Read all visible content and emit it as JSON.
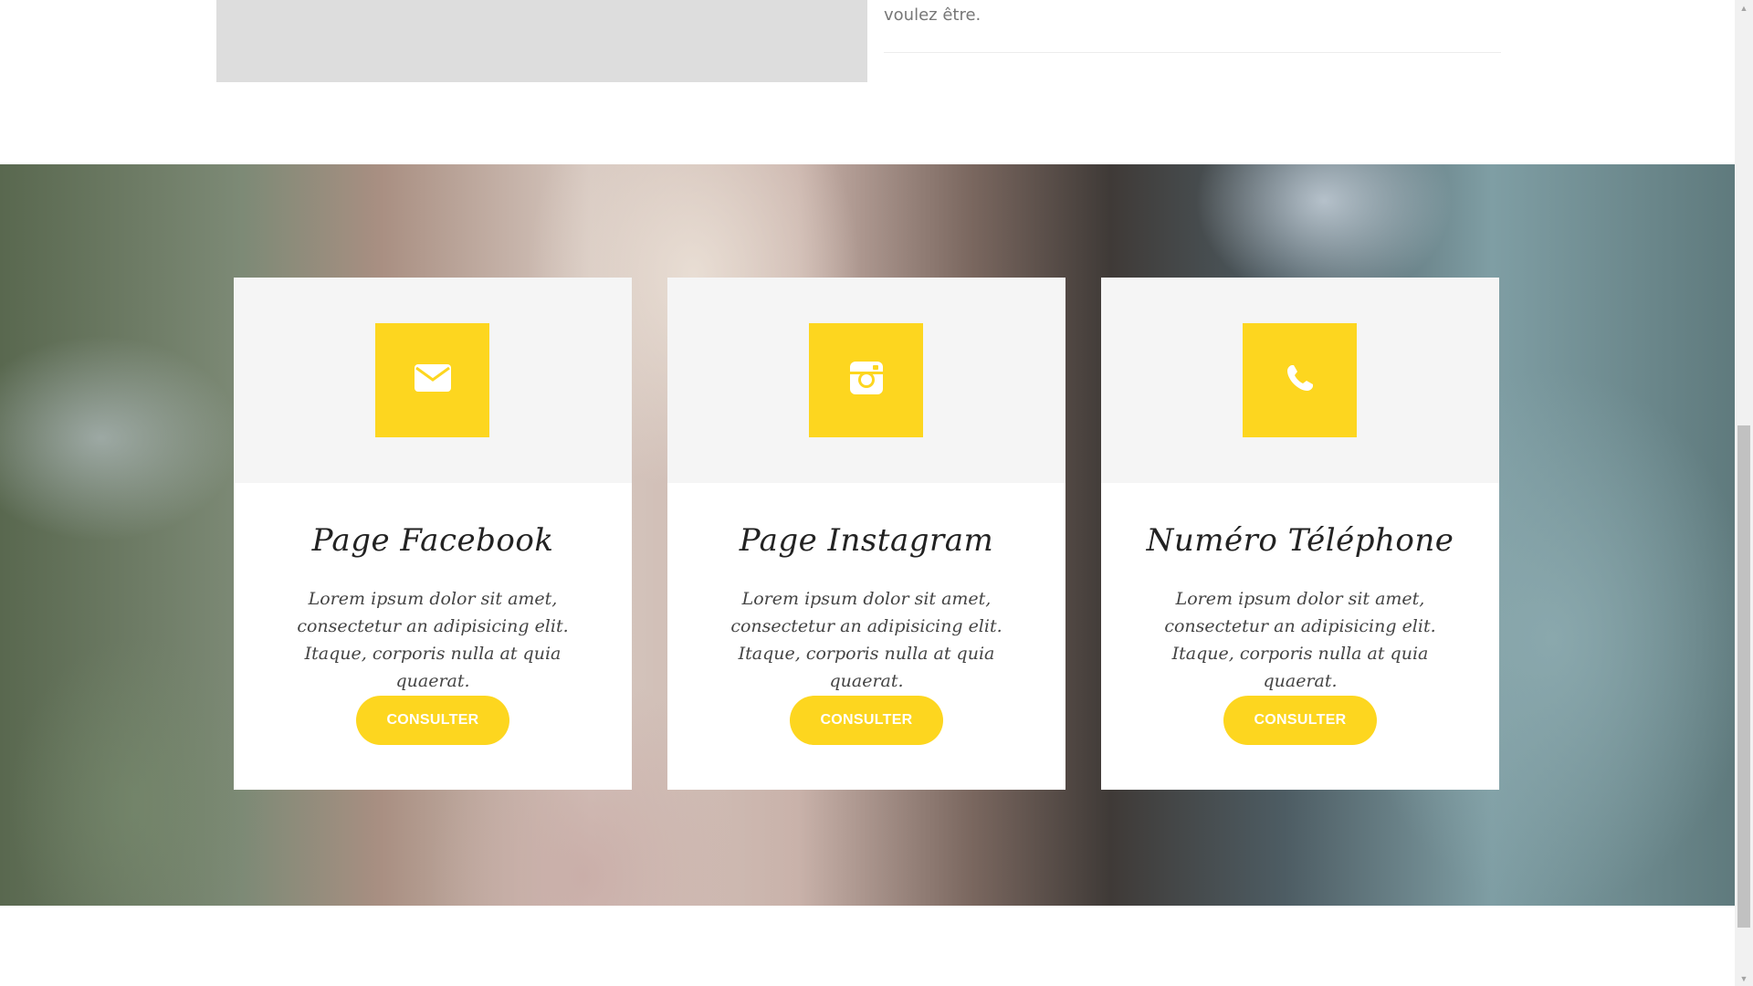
{
  "top": {
    "text": "voulez être."
  },
  "colors": {
    "accent": "#fdd61f",
    "card_top": "#f5f5f5"
  },
  "cards": [
    {
      "icon": "envelope-icon",
      "title": "Page Facebook",
      "body": "Lorem ipsum dolor sit amet, consectetur an adipisicing elit. Itaque, corporis nulla at quia quaerat.",
      "button": "CONSULTER"
    },
    {
      "icon": "instagram-icon",
      "title": "Page Instagram",
      "body": "Lorem ipsum dolor sit amet, consectetur an adipisicing elit. Itaque, corporis nulla at quia quaerat.",
      "button": "CONSULTER"
    },
    {
      "icon": "phone-icon",
      "title": "Numéro Téléphone",
      "body": "Lorem ipsum dolor sit amet, consectetur an adipisicing elit. Itaque, corporis nulla at quia quaerat.",
      "button": "CONSULTER"
    }
  ]
}
